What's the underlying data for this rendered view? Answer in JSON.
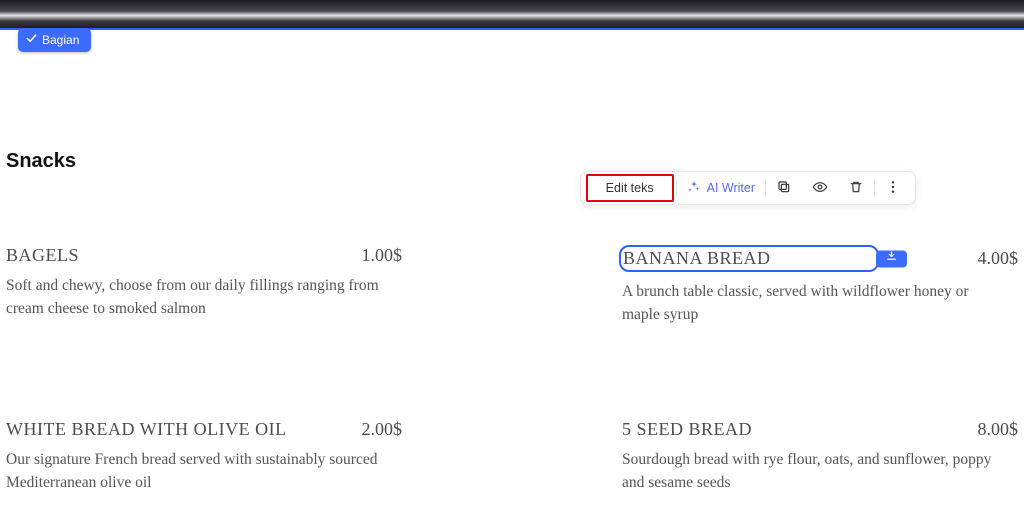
{
  "badge": {
    "label": "Bagian"
  },
  "toolbar": {
    "edit_label": "Edit teks",
    "ai_label": "AI Writer"
  },
  "section": {
    "title": "Snacks",
    "items": [
      {
        "name": "BAGELS",
        "price": "1.00$",
        "desc": "Soft and chewy, choose from our daily fillings ranging from cream cheese to smoked salmon"
      },
      {
        "name": "BANANA BREAD",
        "price": "4.00$",
        "desc": "A brunch table classic, served with wildflower honey or maple syrup"
      },
      {
        "name": "WHITE BREAD WITH OLIVE OIL",
        "price": "2.00$",
        "desc": "Our signature French bread served with sustainably sourced Mediterranean olive oil"
      },
      {
        "name": "5 SEED BREAD",
        "price": "8.00$",
        "desc": "Sourdough bread with rye flour, oats, and sunflower, poppy and sesame seeds"
      }
    ]
  }
}
